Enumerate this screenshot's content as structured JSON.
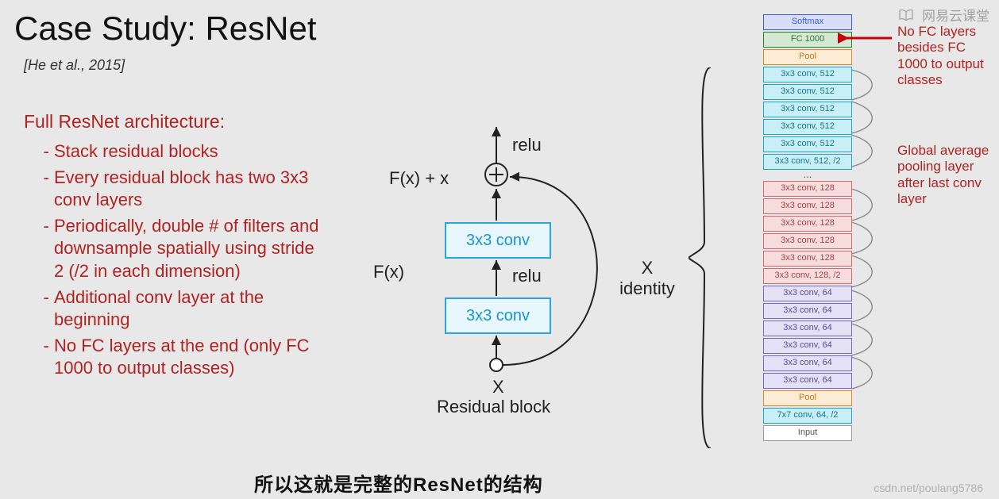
{
  "title": "Case Study: ResNet",
  "citation": "[He et al., 2015]",
  "bullets": {
    "heading": "Full ResNet architecture:",
    "items": [
      "Stack residual blocks",
      "Every residual block has two 3x3 conv layers",
      "Periodically, double # of filters and downsample spatially using stride 2 (/2 in each dimension)",
      "Additional conv layer at the beginning",
      "No FC layers at the end (only FC 1000 to output classes)"
    ]
  },
  "diagram": {
    "conv_label": "3x3 conv",
    "relu": "relu",
    "fxx": "F(x) + x",
    "fx": "F(x)",
    "x": "X",
    "residual_block": "Residual block",
    "x_identity": "X\nidentity"
  },
  "arch": {
    "layers": [
      {
        "cls": "softmax",
        "label": "Softmax"
      },
      {
        "cls": "fc1000",
        "label": "FC 1000"
      },
      {
        "cls": "pool",
        "label": "Pool"
      },
      {
        "cls": "cyan",
        "label": "3x3 conv, 512"
      },
      {
        "cls": "cyan",
        "label": "3x3 conv, 512"
      },
      {
        "cls": "cyan",
        "label": "3x3 conv, 512"
      },
      {
        "cls": "cyan",
        "label": "3x3 conv, 512"
      },
      {
        "cls": "cyan",
        "label": "3x3 conv, 512"
      },
      {
        "cls": "cyan",
        "label": "3x3 conv, 512, /2"
      },
      {
        "cls": "dots",
        "label": "..."
      },
      {
        "cls": "pink",
        "label": "3x3 conv, 128"
      },
      {
        "cls": "pink",
        "label": "3x3 conv, 128"
      },
      {
        "cls": "pink",
        "label": "3x3 conv, 128"
      },
      {
        "cls": "pink",
        "label": "3x3 conv, 128"
      },
      {
        "cls": "pink",
        "label": "3x3 conv, 128"
      },
      {
        "cls": "pink",
        "label": "3x3 conv, 128, /2"
      },
      {
        "cls": "purple",
        "label": "3x3 conv, 64"
      },
      {
        "cls": "purple",
        "label": "3x3 conv, 64"
      },
      {
        "cls": "purple",
        "label": "3x3 conv, 64"
      },
      {
        "cls": "purple",
        "label": "3x3 conv, 64"
      },
      {
        "cls": "purple",
        "label": "3x3 conv, 64"
      },
      {
        "cls": "purple",
        "label": "3x3 conv, 64"
      },
      {
        "cls": "pool",
        "label": "Pool"
      },
      {
        "cls": "cyan",
        "label": "7x7 conv, 64, /2"
      },
      {
        "cls": "input",
        "label": "Input"
      }
    ]
  },
  "annotations": {
    "a1": "No FC layers besides FC 1000 to output classes",
    "a2": "Global average pooling layer after last conv layer"
  },
  "watermark": "网易云课堂",
  "lower_watermark": "csdn.net/poulang5786",
  "partial_caption": "所以这就是完整的ResNet的结构"
}
